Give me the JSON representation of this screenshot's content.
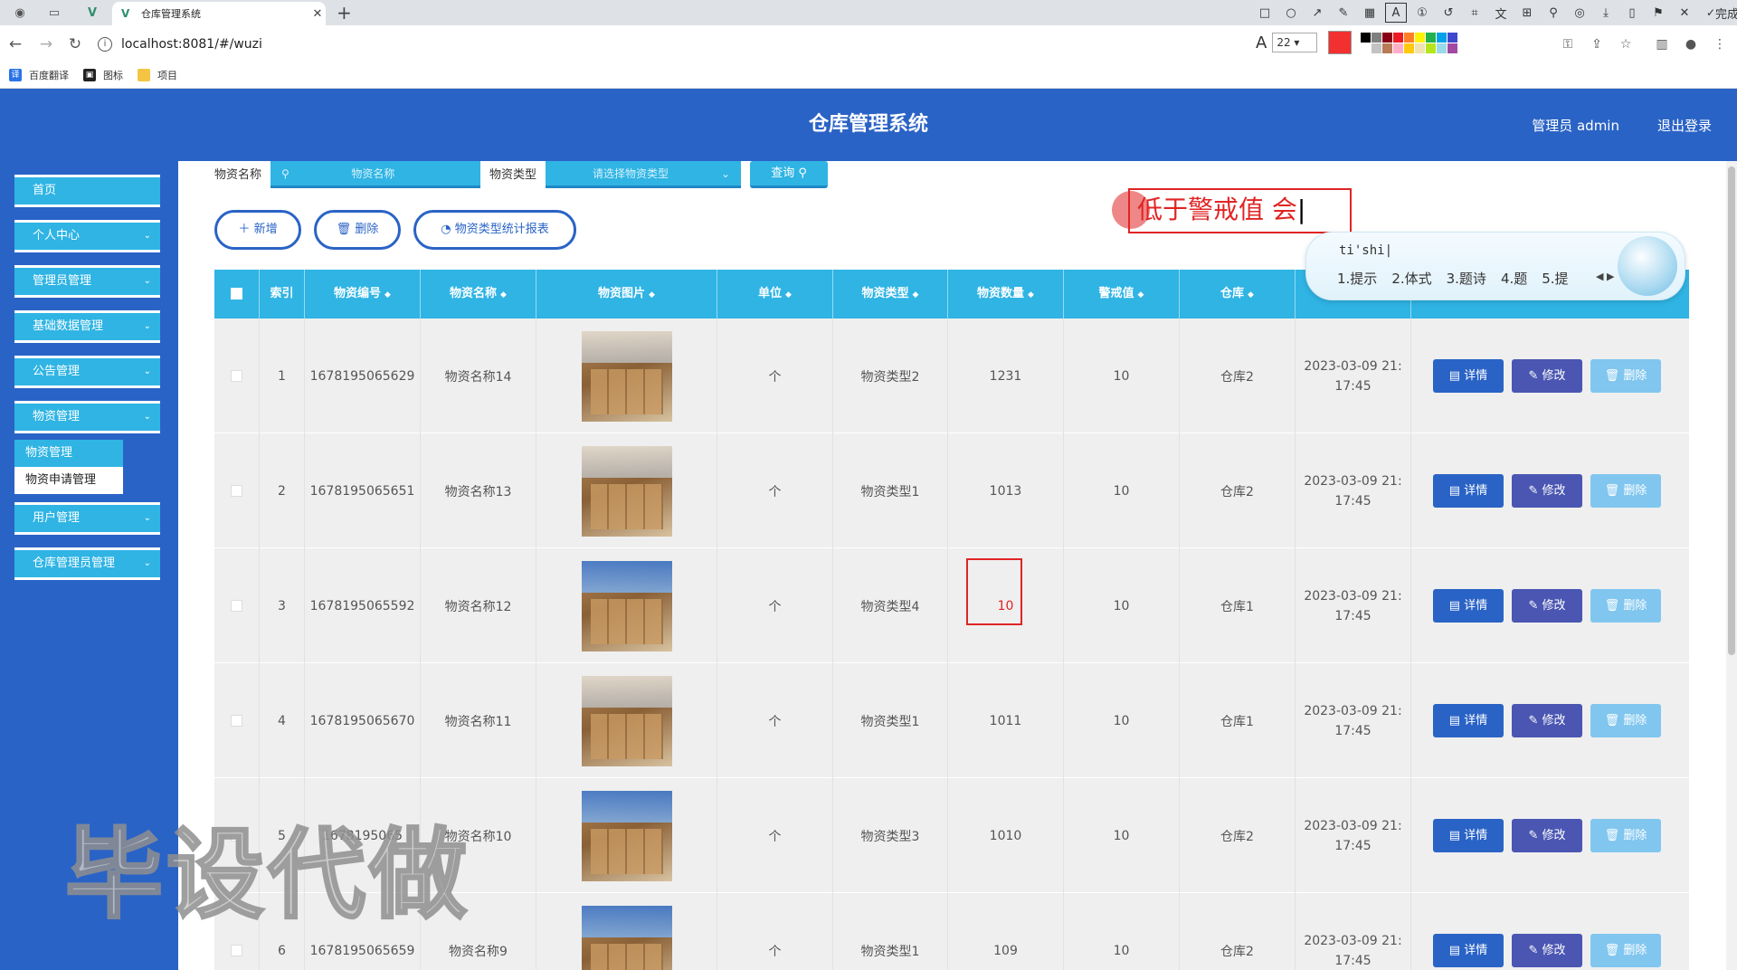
{
  "browser": {
    "tab_title": "仓库管理系统",
    "url": "localhost:8081/#/wuzi",
    "finish_label": "完成",
    "pen_size": "22",
    "pen_color": "#f23030",
    "palette": [
      "#000000",
      "#7f7f7f",
      "#880015",
      "#ed1c24",
      "#ff7f27",
      "#fff200",
      "#22b14c",
      "#00a2e8",
      "#3f48cc",
      "#ffffff",
      "#c3c3c3",
      "#b97a57",
      "#ffaec9",
      "#ffc90e",
      "#efe4b0",
      "#b5e61d",
      "#99d9ea",
      "#a349a4"
    ],
    "bookmarks": [
      {
        "label": "百度翻译",
        "icon": "translate-icon"
      },
      {
        "label": "图标",
        "icon": "image-icon"
      },
      {
        "label": "项目",
        "icon": "folder-icon"
      }
    ]
  },
  "app": {
    "title": "仓库管理系统",
    "user_label": "管理员 admin",
    "logout_label": "退出登录",
    "primary_color": "#2a63c6",
    "accent_color": "#2fb4e4"
  },
  "sidebar": {
    "items": [
      {
        "label": "首页",
        "has_arrow": false
      },
      {
        "label": "个人中心",
        "has_arrow": true
      },
      {
        "label": "管理员管理",
        "has_arrow": true
      },
      {
        "label": "基础数据管理",
        "has_arrow": true
      },
      {
        "label": "公告管理",
        "has_arrow": true
      },
      {
        "label": "物资管理",
        "has_arrow": true
      },
      {
        "label": "用户管理",
        "has_arrow": true
      },
      {
        "label": "仓库管理员管理",
        "has_arrow": true
      }
    ],
    "submenu": [
      {
        "label": "物资管理",
        "active": true
      },
      {
        "label": "物资申请管理",
        "active": false
      }
    ]
  },
  "search": {
    "name_label": "物资名称",
    "name_placeholder": "物资名称",
    "type_label": "物资类型",
    "type_placeholder": "请选择物资类型",
    "query_label": "查询"
  },
  "actions": {
    "add_label": "新增",
    "delete_label": "删除",
    "report_label": "物资类型统计报表"
  },
  "table": {
    "columns": [
      "索引",
      "物资编号",
      "物资名称",
      "物资图片",
      "单位",
      "物资类型",
      "物资数量",
      "警戒值",
      "仓库",
      ""
    ],
    "op_detail": "详情",
    "op_edit": "修改",
    "op_delete": "删除",
    "rows": [
      {
        "index": "1",
        "code": "1678195065629",
        "name": "物资名称14",
        "unit": "个",
        "type": "物资类型2",
        "qty": "1231",
        "alert": "10",
        "warehouse": "仓库2",
        "date": "2023-03-09 21:",
        "time": "17:45"
      },
      {
        "index": "2",
        "code": "1678195065651",
        "name": "物资名称13",
        "unit": "个",
        "type": "物资类型1",
        "qty": "1013",
        "alert": "10",
        "warehouse": "仓库2",
        "date": "2023-03-09 21:",
        "time": "17:45"
      },
      {
        "index": "3",
        "code": "1678195065592",
        "name": "物资名称12",
        "unit": "个",
        "type": "物资类型4",
        "qty": "10",
        "alert": "10",
        "warehouse": "仓库1",
        "date": "2023-03-09 21:",
        "time": "17:45"
      },
      {
        "index": "4",
        "code": "1678195065670",
        "name": "物资名称11",
        "unit": "个",
        "type": "物资类型1",
        "qty": "1011",
        "alert": "10",
        "warehouse": "仓库1",
        "date": "2023-03-09 21:",
        "time": "17:45"
      },
      {
        "index": "5",
        "code": "1678195065",
        "name": "物资名称10",
        "unit": "个",
        "type": "物资类型3",
        "qty": "1010",
        "alert": "10",
        "warehouse": "仓库2",
        "date": "2023-03-09 21:",
        "time": "17:45"
      },
      {
        "index": "6",
        "code": "1678195065659",
        "name": "物资名称9",
        "unit": "个",
        "type": "物资类型1",
        "qty": "109",
        "alert": "10",
        "warehouse": "仓库2",
        "date": "2023-03-09 21:",
        "time": "17:45"
      }
    ]
  },
  "annotation": {
    "text": "低于警戒值 会",
    "color": "#e02424"
  },
  "ime": {
    "pinyin": "ti'shi",
    "candidates": [
      "1.提示",
      "2.体式",
      "3.题诗",
      "4.题",
      "5.提"
    ]
  },
  "watermark": "毕设代做"
}
